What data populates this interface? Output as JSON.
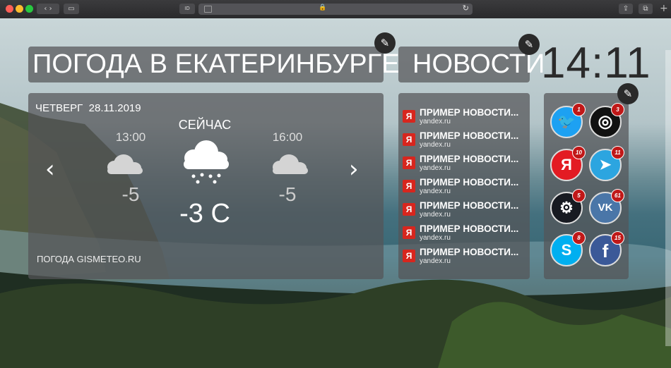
{
  "browser": {
    "tab_icon_label": "ID",
    "colors": {
      "close": "#fe5f57",
      "minimize": "#febc2e",
      "zoom": "#28c840"
    }
  },
  "weather": {
    "title": "ПОГОДА В ЕКАТЕРИНБУРГЕ",
    "day": "ЧЕТВЕРГ",
    "date": "28.11.2019",
    "now_label": "СЕЙЧАС",
    "now_temp": "-3 C",
    "now_icon": "snow-cloud-icon",
    "left_time": "13:00",
    "left_temp": "-5",
    "left_icon": "cloud-icon",
    "right_time": "16:00",
    "right_temp": "-5",
    "right_icon": "cloud-icon",
    "source": "ПОГОДА GISMETEO.RU"
  },
  "news": {
    "title": "НОВОСТИ",
    "items": [
      {
        "text": "ПРИМЕР НОВОСТИ...",
        "source": "yandex.ru",
        "icon": "Я"
      },
      {
        "text": "ПРИМЕР НОВОСТИ...",
        "source": "yandex.ru",
        "icon": "Я"
      },
      {
        "text": "ПРИМЕР НОВОСТИ...",
        "source": "yandex.ru",
        "icon": "Я"
      },
      {
        "text": "ПРИМЕР НОВОСТИ...",
        "source": "yandex.ru",
        "icon": "Я"
      },
      {
        "text": "ПРИМЕР НОВОСТИ...",
        "source": "yandex.ru",
        "icon": "Я"
      },
      {
        "text": "ПРИМЕР НОВОСТИ...",
        "source": "yandex.ru",
        "icon": "Я"
      },
      {
        "text": "ПРИМЕР НОВОСТИ...",
        "source": "yandex.ru",
        "icon": "Я"
      }
    ]
  },
  "clock": {
    "time": "14:11"
  },
  "social": [
    {
      "name": "twitter",
      "badge": "1",
      "color": "#1da1f2",
      "glyph": "🐦"
    },
    {
      "name": "instagram",
      "badge": "3",
      "color": "#111111",
      "glyph": "◎"
    },
    {
      "name": "yandex",
      "badge": "10",
      "color": "#e31b23",
      "glyph": "Я"
    },
    {
      "name": "telegram",
      "badge": "11",
      "color": "#2ca5e0",
      "glyph": "➤"
    },
    {
      "name": "steam",
      "badge": "5",
      "color": "#171a21",
      "glyph": "⚙"
    },
    {
      "name": "vk",
      "badge": "61",
      "color": "#4a76a8",
      "glyph": "VK"
    },
    {
      "name": "skype",
      "badge": "8",
      "color": "#00aff0",
      "glyph": "S"
    },
    {
      "name": "facebook",
      "badge": "15",
      "color": "#3b5998",
      "glyph": "f"
    }
  ]
}
